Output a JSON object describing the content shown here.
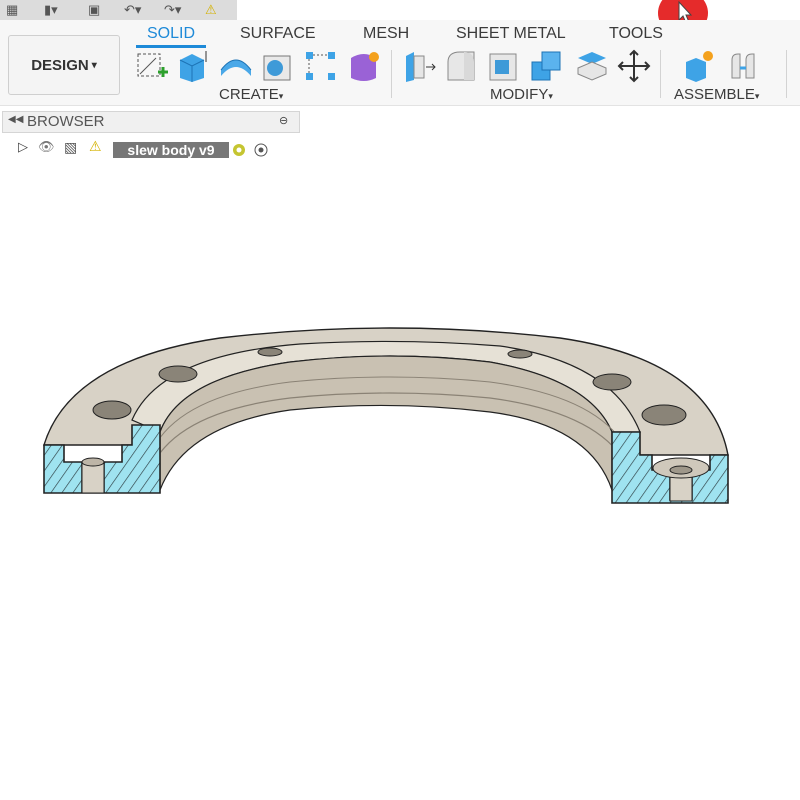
{
  "ribbon": {
    "tabs": [
      {
        "label": "SOLID"
      },
      {
        "label": "SURFACE"
      },
      {
        "label": "MESH"
      },
      {
        "label": "SHEET METAL"
      },
      {
        "label": "TOOLS"
      }
    ],
    "workspace_button": "DESIGN",
    "groups": {
      "create": "CREATE",
      "modify": "MODIFY",
      "assemble": "ASSEMBLE"
    },
    "accent_color": "#1e8ad8"
  },
  "browser": {
    "title": "BROWSER",
    "component_name": "slew body v9"
  },
  "model": {
    "hatch_color": "#9fe3f0",
    "body_color": "#d8d2c6"
  }
}
